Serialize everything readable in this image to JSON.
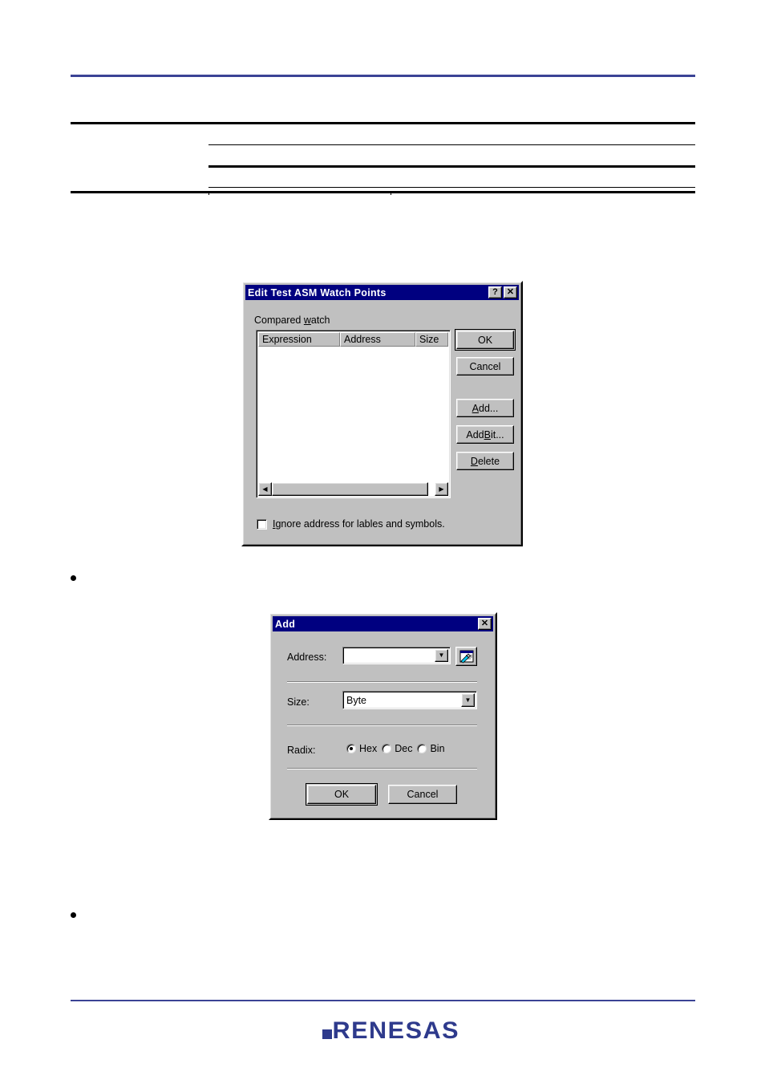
{
  "page": {
    "brand": {
      "logo_text": "RENESAS"
    }
  },
  "header_table": {
    "note": "rules only, no visible text"
  },
  "bullets": [
    {
      "text": ""
    },
    {
      "text": ""
    }
  ],
  "dialogs": {
    "watch_points": {
      "title": "Edit Test ASM Watch Points",
      "title_buttons": {
        "help": "?",
        "close": "✕"
      },
      "group_label_pre": "Compared ",
      "group_label_mnemonic": "w",
      "group_label_post": "atch",
      "list_columns": [
        "Expression",
        "Address",
        "Size"
      ],
      "list_rows": [],
      "buttons": {
        "ok": "OK",
        "cancel": "Cancel",
        "add_pre": "",
        "add_mnemonic": "A",
        "add_post": "dd...",
        "add_bit_pre": "Add ",
        "add_bit_mnemonic": "B",
        "add_bit_post": "it...",
        "delete_pre": "",
        "delete_mnemonic": "D",
        "delete_post": "elete"
      },
      "scrollbar": {
        "left_arrow": "◀",
        "right_arrow": "▶"
      },
      "checkbox": {
        "label_pre": "",
        "label_mnemonic": "I",
        "label_post": "gnore address for lables and symbols.",
        "checked": false
      }
    },
    "add": {
      "title": "Add",
      "title_buttons": {
        "close": "✕"
      },
      "address": {
        "label": "Address:",
        "value": "",
        "placeholder": "",
        "dropdown_arrow": "▼",
        "browse_icon": "browse-symbol-icon"
      },
      "size": {
        "label": "Size:",
        "value": "Byte",
        "dropdown_arrow": "▼",
        "options": [
          "Byte"
        ]
      },
      "radix": {
        "label": "Radix:",
        "options": [
          {
            "label": "Hex",
            "checked": true
          },
          {
            "label": "Dec",
            "checked": false
          },
          {
            "label": "Bin",
            "checked": false
          }
        ]
      },
      "buttons": {
        "ok": "OK",
        "cancel": "Cancel"
      }
    }
  },
  "colors": {
    "brand_blue": "#2e3a8c",
    "rule_blue": "#3b4395",
    "titlebar": "#000080",
    "dialog_face": "#c0c0c0"
  }
}
